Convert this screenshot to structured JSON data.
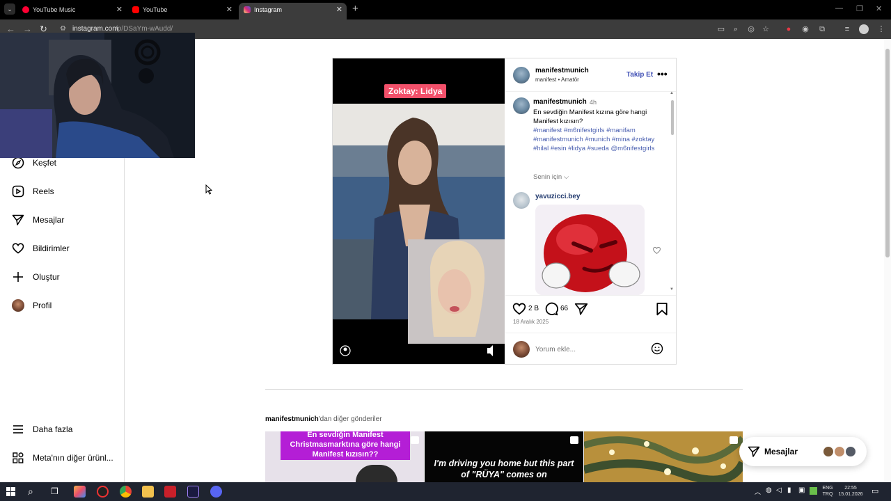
{
  "browser": {
    "tabs": [
      {
        "title": "YouTube Music",
        "active": false,
        "favicon_color": "#ff0033"
      },
      {
        "title": "YouTube",
        "active": false,
        "favicon_color": "#ff0000"
      },
      {
        "title": "Instagram",
        "active": true,
        "favicon_color": "#d62976"
      }
    ],
    "url_host": "instagram.com",
    "url_path": "/p/DSaYm-wAudd/"
  },
  "sidebar": {
    "items": [
      {
        "label": "Keşfet",
        "icon": "compass-icon"
      },
      {
        "label": "Reels",
        "icon": "reels-icon"
      },
      {
        "label": "Mesajlar",
        "icon": "paper-plane-icon"
      },
      {
        "label": "Bildirimler",
        "icon": "heart-icon"
      },
      {
        "label": "Oluştur",
        "icon": "plus-icon"
      },
      {
        "label": "Profil",
        "icon": "profile-avatar"
      }
    ],
    "bottom": [
      {
        "label": "Daha fazla",
        "icon": "hamburger-icon"
      },
      {
        "label": "Meta'nın diğer ürünl...",
        "icon": "grid-icon"
      }
    ]
  },
  "post": {
    "media_caption": "Zoktay: Lidya",
    "author": "manifestmunich",
    "author_sub": "manifest • Amatör",
    "follow_label": "Takip Et",
    "more_label": "•••",
    "caption": {
      "user": "manifestmunich",
      "time": "4h",
      "text": "En sevdiğin Manifest kızına göre hangi Manifest kızısın?",
      "hashtags": "#manifest #m6nifestgirls #manifam #manifestmunich #munich #mina #zoktay #hilal #esin #lidya #sueda @m6nifestgirls"
    },
    "sort_label": "Senin için ⌵",
    "comment": {
      "user": "yavuzicci.bey"
    },
    "likes": "2 B",
    "comments": "66",
    "date": "18 Aralık 2025",
    "comment_placeholder": "Yorum ekle..."
  },
  "more_posts": {
    "user": "manifestmunich",
    "suffix": "'dan diğer gönderiler",
    "thumbs": [
      {
        "text": "En sevdiğin Manifest Christmasmarktına göre hangi Manifest kızısın??"
      },
      {
        "text": "I'm driving you home but this part of \"RÜYA\" comes on"
      },
      {
        "text": ""
      }
    ]
  },
  "messages_pill": {
    "label": "Mesajlar"
  },
  "taskbar": {
    "lang_top": "ENG",
    "lang_bottom": "TRQ",
    "time": "22:55",
    "date": "15.01.2026"
  }
}
